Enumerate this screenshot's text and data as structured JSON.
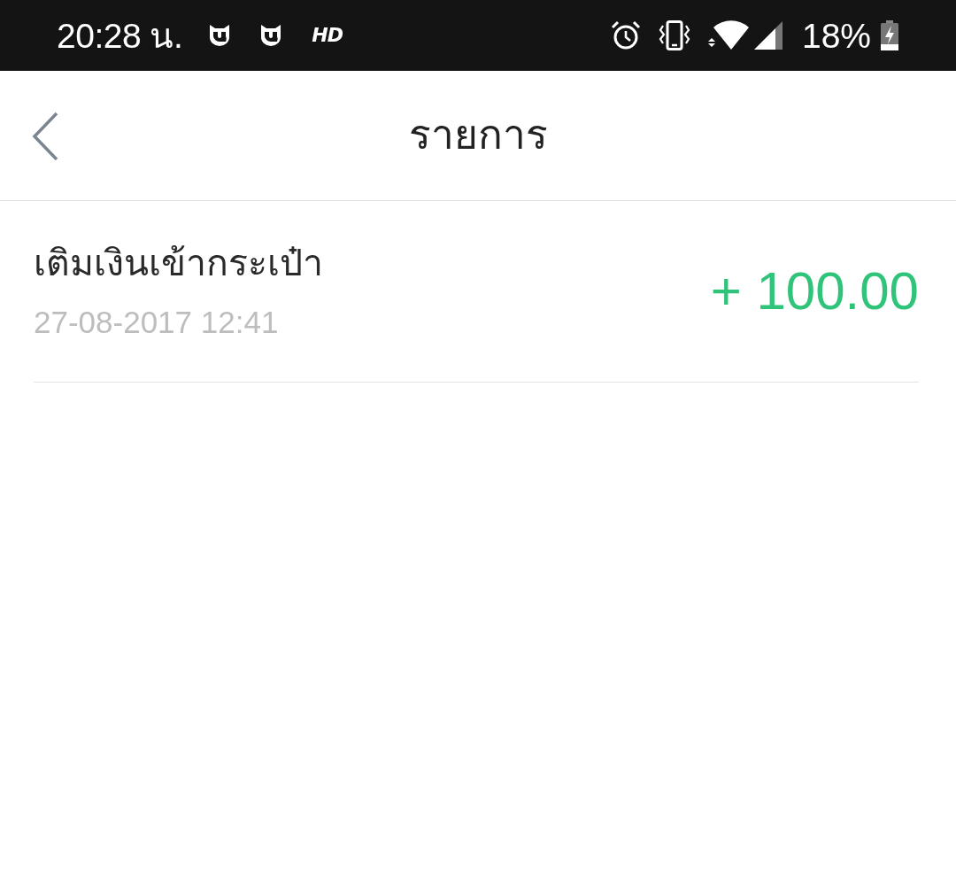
{
  "status_bar": {
    "time": "20:28 น.",
    "hd_label": "HD",
    "battery_percent": "18%",
    "charging": true
  },
  "header": {
    "title": "รายการ"
  },
  "transactions": [
    {
      "title": "เติมเงินเข้ากระเป๋า",
      "datetime": "27-08-2017 12:41",
      "amount": "+ 100.00"
    }
  ]
}
